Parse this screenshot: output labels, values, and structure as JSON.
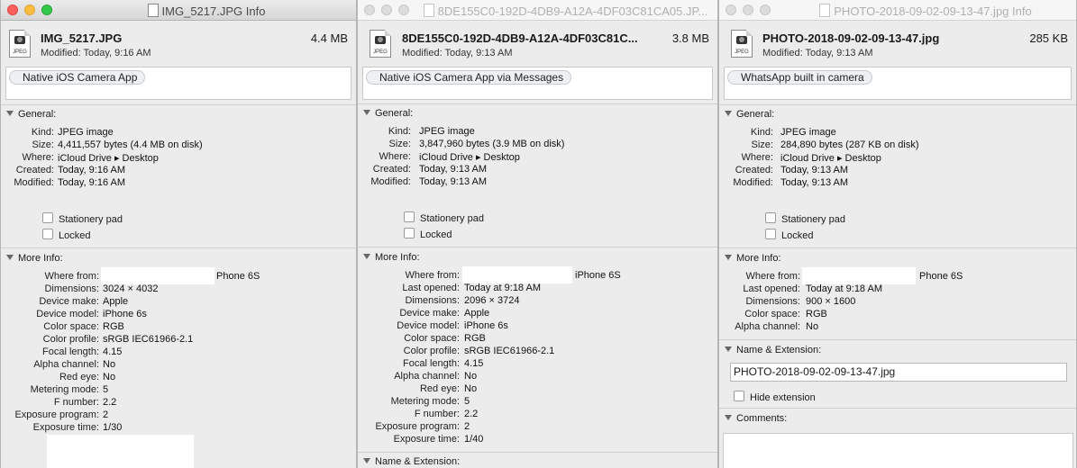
{
  "windows": [
    {
      "title": "IMG_5217.JPG Info",
      "file_name": "IMG_5217.JPG",
      "file_size": "4.4 MB",
      "modified": "Modified: Today, 9:16 AM",
      "icon_ext": "JPEG",
      "comment_tag": "Native iOS Camera App",
      "general_header": "General:",
      "general": [
        {
          "label": "Kind:",
          "value": "JPEG image"
        },
        {
          "label": "Size:",
          "value": "4,411,557 bytes (4.4 MB on disk)"
        },
        {
          "label": "Where:",
          "value": "iCloud Drive ▸ Desktop"
        },
        {
          "label": "Created:",
          "value": "Today, 9:16 AM"
        },
        {
          "label": "Modified:",
          "value": "Today, 9:16 AM"
        }
      ],
      "stationery": "Stationery pad",
      "locked": "Locked",
      "more_header": "More Info:",
      "more": [
        {
          "label": "Where from:",
          "value": "Phone 6S"
        },
        {
          "label": "Dimensions:",
          "value": "3024 × 4032"
        },
        {
          "label": "Device make:",
          "value": "Apple"
        },
        {
          "label": "Device model:",
          "value": "iPhone 6s"
        },
        {
          "label": "Color space:",
          "value": "RGB"
        },
        {
          "label": "Color profile:",
          "value": "sRGB IEC61966-2.1"
        },
        {
          "label": "Focal length:",
          "value": "4.15"
        },
        {
          "label": "Alpha channel:",
          "value": "No"
        },
        {
          "label": "Red eye:",
          "value": "No"
        },
        {
          "label": "Metering mode:",
          "value": "5"
        },
        {
          "label": "F number:",
          "value": "2.2"
        },
        {
          "label": "Exposure program:",
          "value": "2"
        },
        {
          "label": "Exposure time:",
          "value": "1/30"
        }
      ]
    },
    {
      "title": "8DE155C0-192D-4DB9-A12A-4DF03C81CA05.JP...",
      "file_name": "8DE155C0-192D-4DB9-A12A-4DF03C81C...",
      "file_size": "3.8 MB",
      "modified": "Modified: Today, 9:13 AM",
      "icon_ext": "JPEG",
      "comment_tag": "Native iOS Camera App via Messages",
      "general_header": "General:",
      "general": [
        {
          "label": "Kind:",
          "value": "JPEG image"
        },
        {
          "label": "Size:",
          "value": "3,847,960 bytes (3.9 MB on disk)"
        },
        {
          "label": "Where:",
          "value": "iCloud Drive ▸ Desktop"
        },
        {
          "label": "Created:",
          "value": "Today, 9:13 AM"
        },
        {
          "label": "Modified:",
          "value": "Today, 9:13 AM"
        }
      ],
      "stationery": "Stationery pad",
      "locked": "Locked",
      "more_header": "More Info:",
      "more": [
        {
          "label": "Where from:",
          "value": "iPhone 6S"
        },
        {
          "label": "Last opened:",
          "value": "Today at 9:18 AM"
        },
        {
          "label": "Dimensions:",
          "value": "2096 × 3724"
        },
        {
          "label": "Device make:",
          "value": "Apple"
        },
        {
          "label": "Device model:",
          "value": "iPhone 6s"
        },
        {
          "label": "Color space:",
          "value": "RGB"
        },
        {
          "label": "Color profile:",
          "value": "sRGB IEC61966-2.1"
        },
        {
          "label": "Focal length:",
          "value": "4.15"
        },
        {
          "label": "Alpha channel:",
          "value": "No"
        },
        {
          "label": "Red eye:",
          "value": "No"
        },
        {
          "label": "Metering mode:",
          "value": "5"
        },
        {
          "label": "F number:",
          "value": "2.2"
        },
        {
          "label": "Exposure program:",
          "value": "2"
        },
        {
          "label": "Exposure time:",
          "value": "1/40"
        }
      ],
      "name_ext_header": "Name & Extension:"
    },
    {
      "title": "PHOTO-2018-09-02-09-13-47.jpg Info",
      "file_name": "PHOTO-2018-09-02-09-13-47.jpg",
      "file_size": "285 KB",
      "modified": "Modified: Today, 9:13 AM",
      "icon_ext": "JPEG",
      "comment_tag": "WhatsApp built in camera",
      "general_header": "General:",
      "general": [
        {
          "label": "Kind:",
          "value": "JPEG image"
        },
        {
          "label": "Size:",
          "value": "284,890 bytes (287 KB on disk)"
        },
        {
          "label": "Where:",
          "value": "iCloud Drive ▸ Desktop"
        },
        {
          "label": "Created:",
          "value": "Today, 9:13 AM"
        },
        {
          "label": "Modified:",
          "value": "Today, 9:13 AM"
        }
      ],
      "stationery": "Stationery pad",
      "locked": "Locked",
      "more_header": "More Info:",
      "more": [
        {
          "label": "Where from:",
          "value": "Phone 6S"
        },
        {
          "label": "Last opened:",
          "value": "Today at 9:18 AM"
        },
        {
          "label": "Dimensions:",
          "value": "900 × 1600"
        },
        {
          "label": "Color space:",
          "value": "RGB"
        },
        {
          "label": "Alpha channel:",
          "value": "No"
        }
      ],
      "name_ext_header": "Name & Extension:",
      "name_ext_value": "PHOTO-2018-09-02-09-13-47.jpg",
      "hide_extension": "Hide extension",
      "comments_header": "Comments:"
    }
  ]
}
